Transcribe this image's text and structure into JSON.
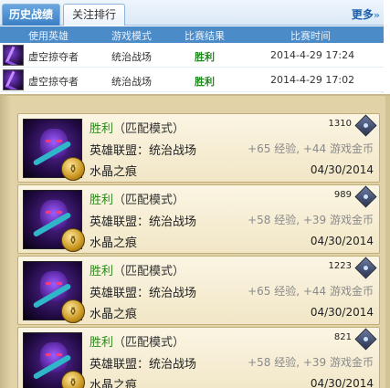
{
  "tabs": {
    "history": "历史战绩",
    "ranking": "关注排行",
    "more": "更多",
    "more_arrows": "»"
  },
  "table": {
    "headers": [
      "使用英雄",
      "游戏模式",
      "比赛结果",
      "比赛时间"
    ],
    "rows": [
      {
        "hero": "虚空掠夺者",
        "mode": "统治战场",
        "result": "胜利",
        "time": "2014-4-29 17:24"
      },
      {
        "hero": "虚空掠夺者",
        "mode": "统治战场",
        "result": "胜利",
        "time": "2014-4-29 17:02"
      }
    ]
  },
  "cards": [
    {
      "result": "胜利",
      "mode": "（匹配模式）",
      "game": "英雄联盟：",
      "map": "统治战场",
      "title": "水晶之痕",
      "ip": "1310",
      "rewards": "+65 经验, +44 游戏金币",
      "date": "04/30/2014"
    },
    {
      "result": "胜利",
      "mode": "（匹配模式）",
      "game": "英雄联盟：",
      "map": "统治战场",
      "title": "水晶之痕",
      "ip": "989",
      "rewards": "+58 经验, +39 游戏金币",
      "date": "04/30/2014"
    },
    {
      "result": "胜利",
      "mode": "（匹配模式）",
      "game": "英雄联盟：",
      "map": "统治战场",
      "title": "水晶之痕",
      "ip": "1223",
      "rewards": "+65 经验, +44 游戏金币",
      "date": "04/30/2014"
    },
    {
      "result": "胜利",
      "mode": "（匹配模式）",
      "game": "英雄联盟：",
      "map": "统治战场",
      "title": "水晶之痕",
      "ip": "821",
      "rewards": "+58 经验, +39 游戏金币",
      "date": "04/30/2014"
    }
  ],
  "icons": {
    "hero_portrait": "void-reaver-portrait",
    "level_badge": "level-badge-icon",
    "ip_icon": "ip-diamond-icon"
  },
  "colors": {
    "win": "#2a8a1a",
    "tab_active": "#3a7fc5",
    "header_bg": "#4b8bc8",
    "card_bg": "#f1e6c6",
    "panel_bg": "#e2d2a8"
  }
}
